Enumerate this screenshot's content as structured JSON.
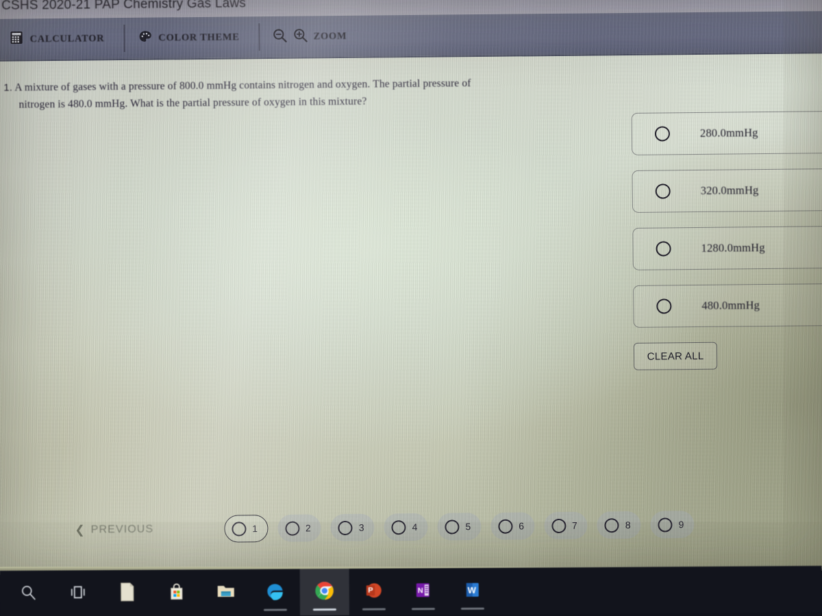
{
  "window": {
    "course_title": "CSHS 2020-21 PAP Chemistry Gas Laws"
  },
  "toolbar": {
    "calculator_label": "CALCULATOR",
    "calculator_icon": "calculator-icon",
    "color_theme_label": "COLOR THEME",
    "color_theme_icon": "palette-icon",
    "zoom_label": "ZOOM",
    "zoom_out_icon": "magnifier-minus-icon",
    "zoom_in_icon": "magnifier-plus-icon",
    "bar_color": "#6a6e87"
  },
  "question": {
    "number": "1.",
    "line1": "A mixture of gases with a pressure of 800.0 mmHg contains nitrogen and oxygen.  The partial pressure of",
    "line2": "nitrogen is 480.0 mmHg.  What is the partial pressure of oxygen in this mixture?"
  },
  "answers": {
    "options": [
      {
        "label": "280.0mmHg",
        "selected": false
      },
      {
        "label": "320.0mmHg",
        "selected": false
      },
      {
        "label": "1280.0mmHg",
        "selected": false
      },
      {
        "label": "480.0mmHg",
        "selected": false
      }
    ],
    "clear_all_label": "CLEAR ALL"
  },
  "pagination": {
    "previous_label": "PREVIOUS",
    "previous_icon": "chevron-left-icon",
    "pages": [
      {
        "num": "1",
        "active": true
      },
      {
        "num": "2",
        "active": false
      },
      {
        "num": "3",
        "active": false
      },
      {
        "num": "4",
        "active": false
      },
      {
        "num": "5",
        "active": false
      },
      {
        "num": "6",
        "active": false
      },
      {
        "num": "7",
        "active": false
      },
      {
        "num": "8",
        "active": false
      },
      {
        "num": "9",
        "active": false
      }
    ]
  },
  "taskbar": {
    "items": [
      {
        "name": "search-icon",
        "active": false
      },
      {
        "name": "task-view-icon",
        "active": false
      },
      {
        "name": "notepad-icon",
        "active": false
      },
      {
        "name": "microsoft-store-icon",
        "active": false
      },
      {
        "name": "file-explorer-icon",
        "active": false
      },
      {
        "name": "edge-browser-icon",
        "active": false
      },
      {
        "name": "chrome-browser-icon",
        "active": true
      },
      {
        "name": "powerpoint-icon",
        "active": false
      },
      {
        "name": "onenote-icon",
        "active": false
      },
      {
        "name": "word-icon",
        "active": false
      }
    ],
    "background_color": "#12141c"
  }
}
